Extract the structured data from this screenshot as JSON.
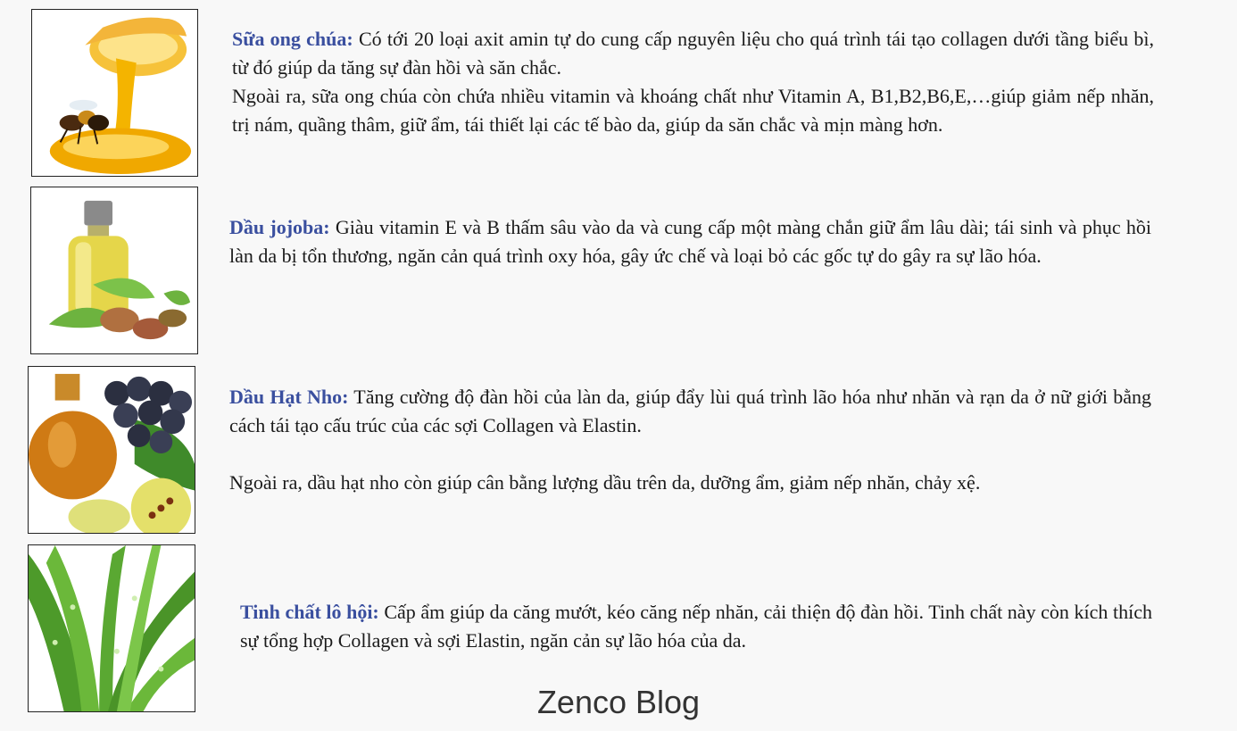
{
  "items": [
    {
      "title": "Sữa ong chúa:",
      "image_icon": "royal-jelly-honey-bee",
      "paragraphs": [
        "Có tới 20 loại axit amin tự do cung cấp nguyên liệu cho quá trình tái tạo collagen dưới tầng biểu bì, từ đó giúp da tăng sự đàn hồi và săn chắc.",
        "Ngoài ra, sữa ong chúa còn chứa nhiều vitamin và khoáng chất như Vitamin A, B1,B2,B6,E,…giúp giảm nếp nhăn, trị nám, quầng thâm, giữ ẩm, tái thiết lại các tế bào da, giúp da săn chắc và mịn màng hơn."
      ]
    },
    {
      "title": "Dầu jojoba:",
      "image_icon": "jojoba-oil-bottle",
      "paragraphs": [
        "Giàu vitamin E và B thấm sâu vào da và cung cấp một màng chắn giữ ẩm lâu dài; tái sinh và phục hồi làn da bị tổn thương, ngăn cản quá trình oxy hóa, gây ức chế và loại bỏ các gốc tự do gây ra sự lão hóa."
      ]
    },
    {
      "title": "Dầu Hạt Nho:",
      "image_icon": "grape-seed-oil",
      "paragraphs": [
        "Tăng cường độ đàn hồi của làn da, giúp đẩy lùi quá trình lão hóa như nhăn và rạn da ở nữ giới bằng cách tái tạo cấu trúc của các sợi Collagen và Elastin.",
        "Ngoài ra, dầu hạt nho còn giúp cân bằng lượng dầu trên da, dưỡng ẩm, giảm nếp nhăn, chảy xệ."
      ]
    },
    {
      "title": "Tinh chất lô hội:",
      "image_icon": "aloe-vera",
      "paragraphs": [
        "Cấp ẩm giúp da căng mướt, kéo căng nếp nhăn, cải thiện độ đàn hồi. Tinh chất này còn kích thích sự tổng hợp Collagen và sợi Elastin, ngăn cản sự lão hóa của da."
      ]
    }
  ],
  "footer": {
    "watermark": "Zenco Blog"
  }
}
